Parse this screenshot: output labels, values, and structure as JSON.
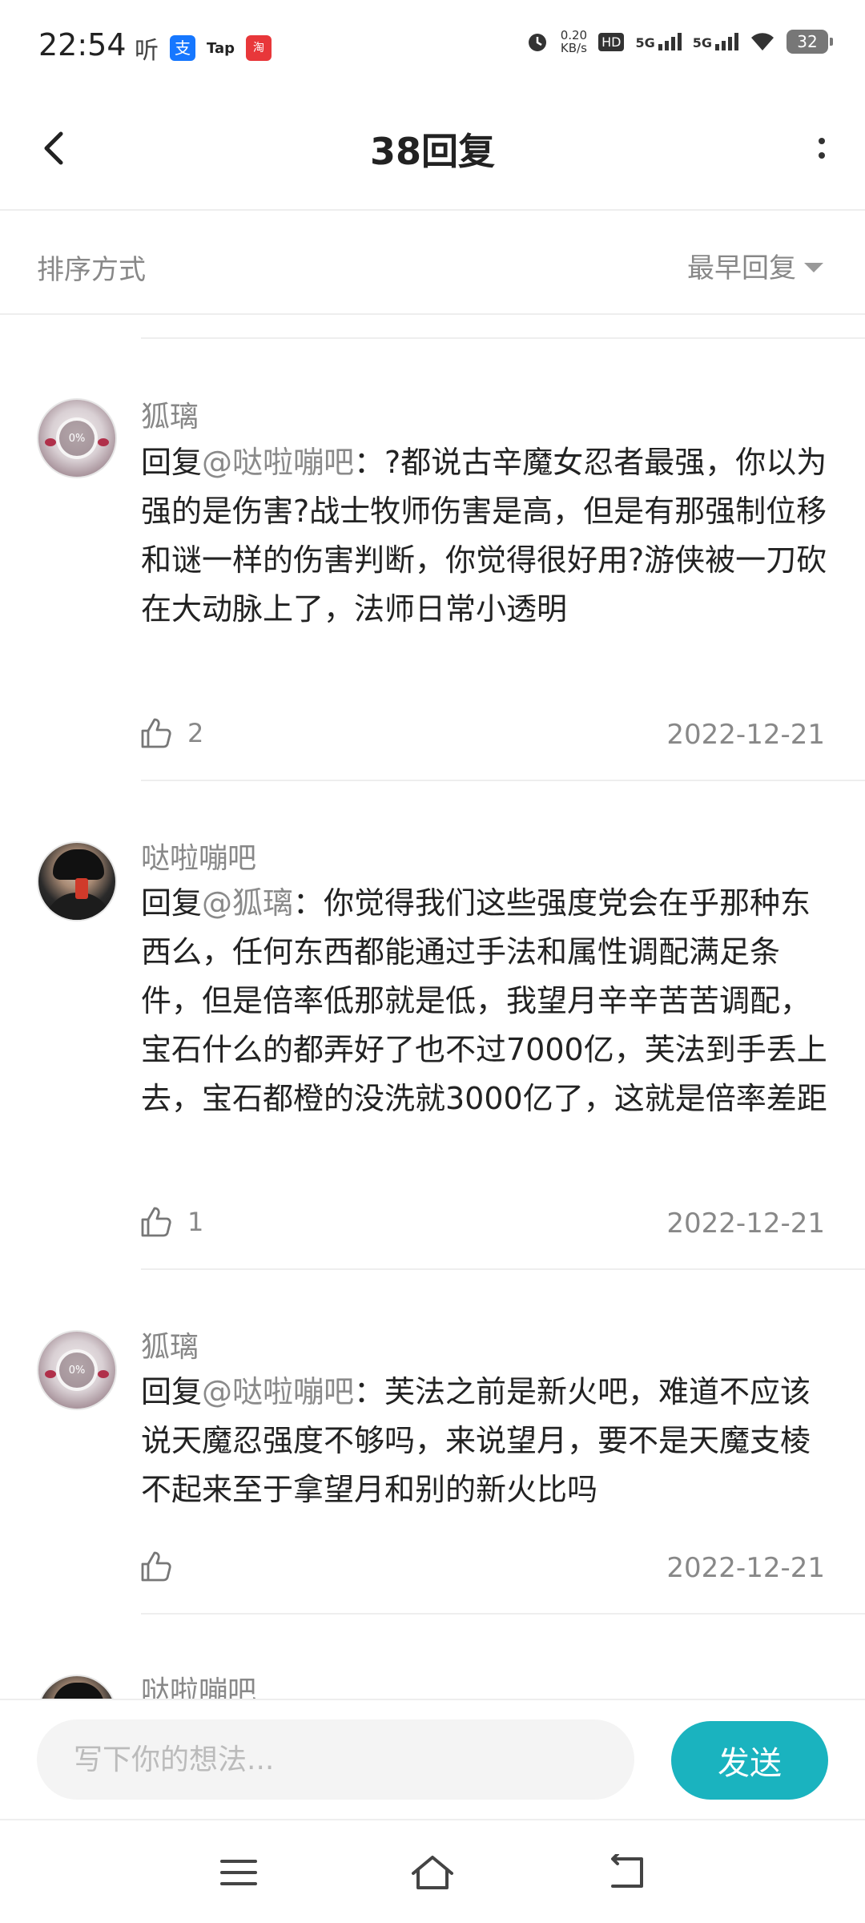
{
  "status_bar": {
    "time": "22:54",
    "listen_glyph": "听",
    "app_tap": "Tap",
    "net_speed_value": "0.20",
    "net_speed_unit": "KB/s",
    "hd_label": "HD",
    "network_1": "5G",
    "network_2": "5G",
    "battery": "32"
  },
  "header": {
    "title": "38回复"
  },
  "sort": {
    "label": "排序方式",
    "selected": "最早回复"
  },
  "comments": [
    {
      "username": "狐璃",
      "reply_prefix": "回复",
      "mention": "@哒啦嘣吧",
      "text": "：?都说古辛魔女忍者最强，你以为强的是伤害?战士牧师伤害是高，但是有那强制位移和谜一样的伤害判断，你觉得很好用?游侠被一刀砍在大动脉上了，法师日常小透明",
      "likes": "2",
      "date": "2022-12-21",
      "avatar_overlay": "0%"
    },
    {
      "username": "哒啦嘣吧",
      "reply_prefix": "回复",
      "mention": "@狐璃",
      "text": "：你觉得我们这些强度党会在乎那种东西么，任何东西都能通过手法和属性调配满足条件，但是倍率低那就是低，我望月辛辛苦苦调配，宝石什么的都弄好了也不过7000亿，芙法到手丢上去，宝石都橙的没洗就3000亿了，这就是倍率差距",
      "likes": "1",
      "date": "2022-12-21"
    },
    {
      "username": "狐璃",
      "reply_prefix": "回复",
      "mention": "@哒啦嘣吧",
      "text": "：芙法之前是新火吧，难道不应该说天魔忍强度不够吗，来说望月，要不是天魔支棱不起来至于拿望月和别的新火比吗",
      "likes": "",
      "date": "2022-12-21",
      "avatar_overlay": "0%"
    },
    {
      "username": "哒啦嘣吧"
    }
  ],
  "input": {
    "placeholder": "写下你的想法..."
  },
  "send_label": "发送",
  "colors": {
    "accent": "#1ab3bf",
    "muted_text": "#888888",
    "primary_text": "#222222",
    "divider": "#eeeeee"
  },
  "icons": {
    "back": "chevron-left-icon",
    "more": "more-vertical-icon",
    "like": "thumbs-up-icon",
    "nav_menu": "menu-icon",
    "nav_home": "home-icon",
    "nav_back": "return-icon"
  }
}
